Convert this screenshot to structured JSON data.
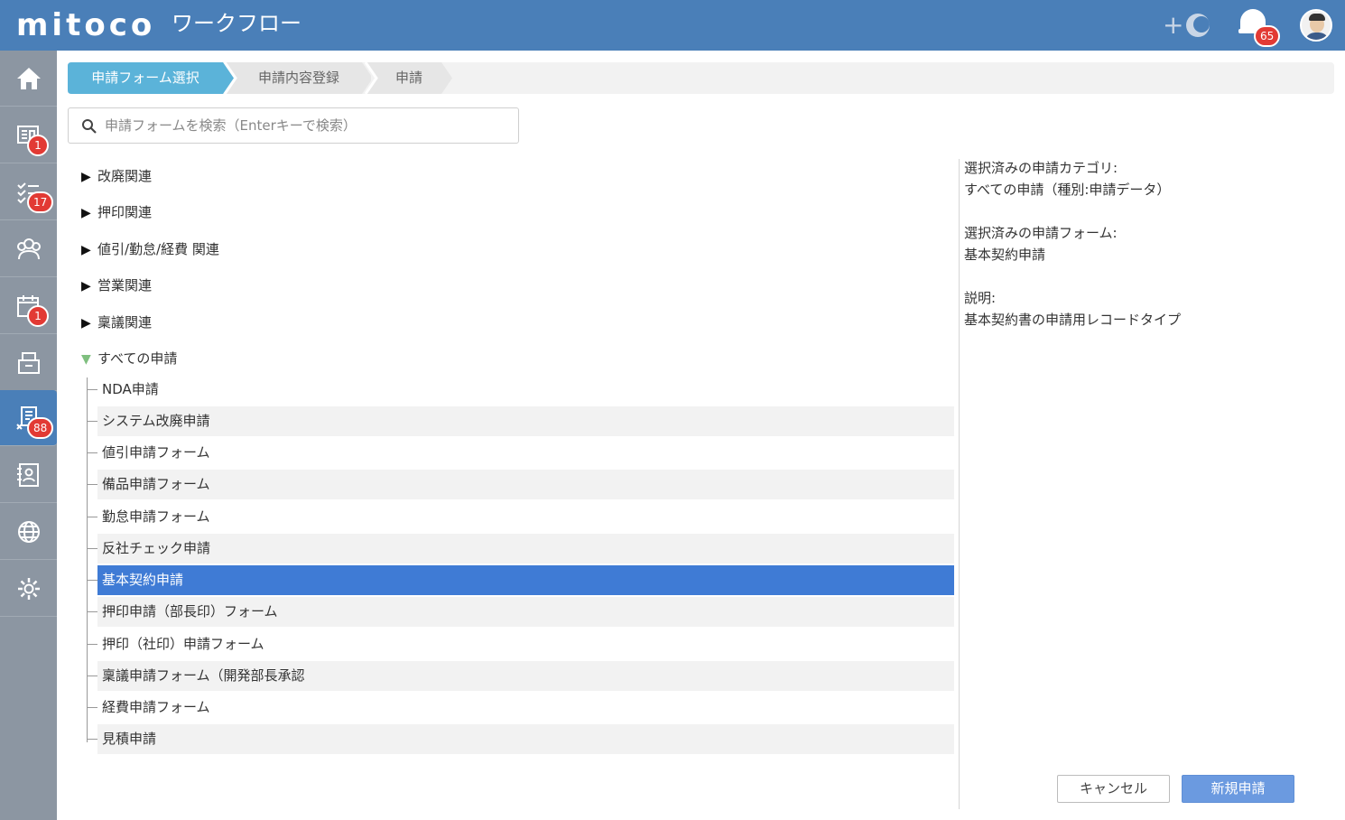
{
  "header": {
    "logo": "mitoco",
    "app_title": "ワークフロー",
    "notification_count": "65"
  },
  "sidebar": {
    "items": [
      {
        "name": "home",
        "badge": ""
      },
      {
        "name": "board",
        "badge": "1"
      },
      {
        "name": "tasks",
        "badge": "17"
      },
      {
        "name": "groups",
        "badge": ""
      },
      {
        "name": "calendar",
        "badge": "1"
      },
      {
        "name": "files",
        "badge": ""
      },
      {
        "name": "workflow",
        "badge": "88"
      },
      {
        "name": "address-book",
        "badge": ""
      },
      {
        "name": "web",
        "badge": ""
      },
      {
        "name": "settings",
        "badge": ""
      }
    ]
  },
  "breadcrumb": {
    "steps": [
      "申請フォーム選択",
      "申請内容登録",
      "申請"
    ]
  },
  "search": {
    "placeholder": "申請フォームを検索（Enterキーで検索）"
  },
  "tree": {
    "categories": [
      "改廃関連",
      "押印関連",
      "値引/勤怠/経費 関連",
      "営業関連",
      "稟議関連",
      "すべての申請"
    ],
    "forms": [
      "NDA申請",
      "システム改廃申請",
      "値引申請フォーム",
      "備品申請フォーム",
      "勤怠申請フォーム",
      "反社チェック申請",
      "基本契約申請",
      "押印申請（部長印）フォーム",
      "押印（社印）申請フォーム",
      "稟議申請フォーム（開発部長承認",
      "経費申請フォーム",
      "見積申請"
    ],
    "selected_form": "基本契約申請"
  },
  "details": {
    "category_label": "選択済みの申請カテゴリ:",
    "category_value": "すべての申請（種別:申請データ）",
    "form_label": "選択済みの申請フォーム:",
    "form_value": "基本契約申請",
    "desc_label": "説明:",
    "desc_value": "基本契約書の申請用レコードタイプ"
  },
  "buttons": {
    "cancel": "キャンセル",
    "submit": "新規申請"
  },
  "colors": {
    "header": "#4a7fb8",
    "sidebar": "#8c96a2",
    "selected_row": "#3f7bd5",
    "badge": "#e23a34",
    "active_crumb": "#5bb3d9"
  }
}
